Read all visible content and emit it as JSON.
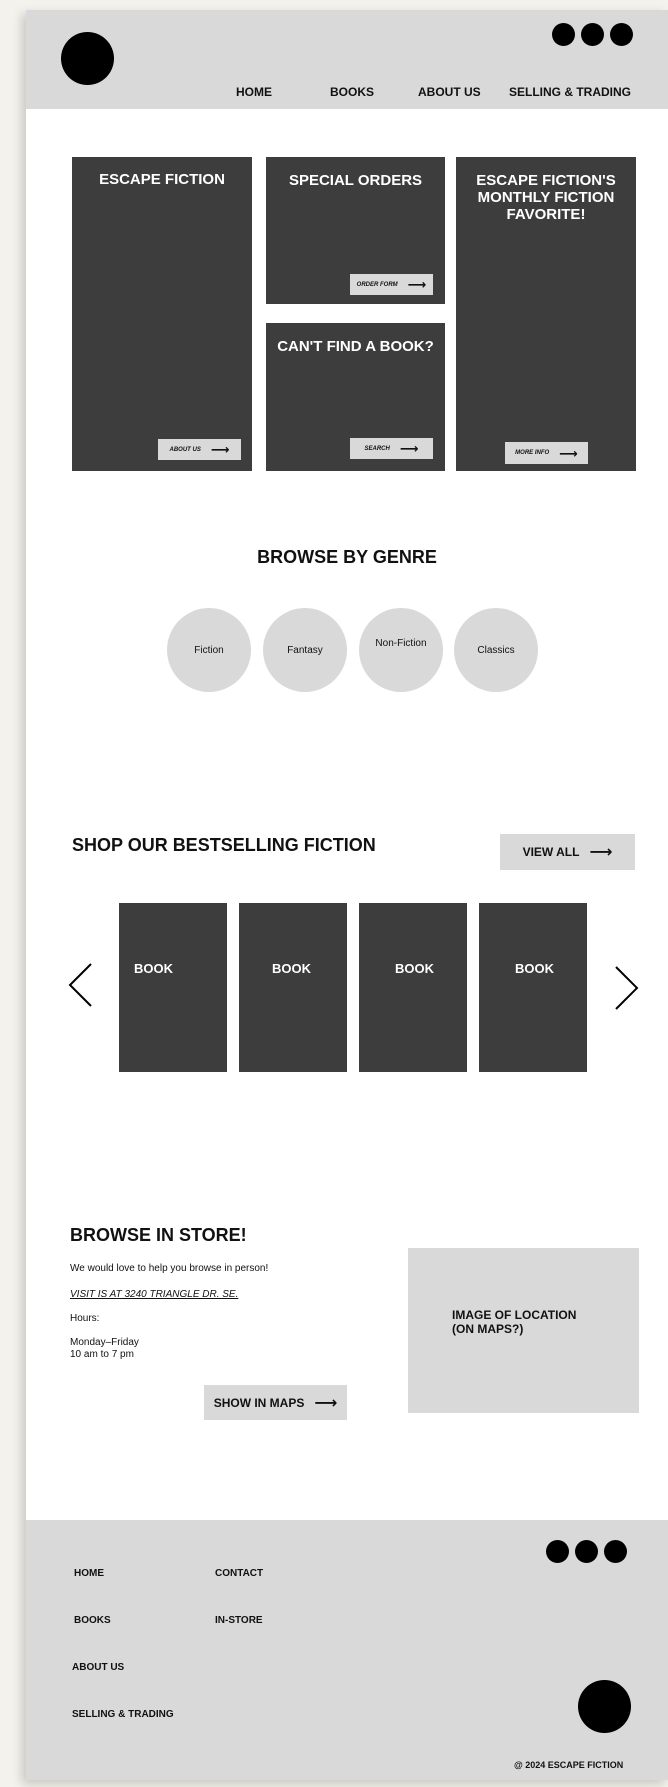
{
  "header": {
    "nav": [
      "HOME",
      "BOOKS",
      "ABOUT US",
      "SELLING & TRADING"
    ]
  },
  "panels": {
    "escape": {
      "title": "ESCAPE FICTION",
      "button": "ABOUT US"
    },
    "special": {
      "title": "SPECIAL ORDERS",
      "button": "ORDER FORM"
    },
    "cantfind": {
      "title": "CAN'T FIND A BOOK?",
      "button": "SEARCH"
    },
    "monthly": {
      "title": "ESCAPE FICTION'S MONTHLY FICTION FAVORITE!",
      "button": "MORE INFO"
    }
  },
  "genres": {
    "title": "BROWSE BY GENRE",
    "items": [
      "Fiction",
      "Fantasy",
      "Non-Fiction",
      "Classics"
    ]
  },
  "bestselling": {
    "title": "SHOP OUR BESTSELLING FICTION",
    "view_all": "VIEW ALL",
    "books": [
      "BOOK",
      "BOOK",
      "BOOK",
      "BOOK"
    ]
  },
  "instore": {
    "title": "BROWSE IN STORE!",
    "intro": "We would love to help you browse in person!",
    "address": "VISIT IS AT 3240 TRIANGLE DR. SE.",
    "hours_label": "Hours:",
    "days": "Monday–Friday",
    "times": "10 am to 7 pm",
    "maps_button": "SHOW IN MAPS",
    "location_line1": "IMAGE OF LOCATION",
    "location_line2": "(ON MAPS?)"
  },
  "footer": {
    "col1": [
      "HOME",
      "BOOKS",
      "ABOUT US",
      "SELLING & TRADING"
    ],
    "col2": [
      "CONTACT",
      "IN-STORE"
    ],
    "copyright": "@ 2024 ESCAPE FICTION"
  },
  "colors": {
    "dark_panel": "#3d3d3d",
    "light_gray": "#d9d9d9"
  },
  "icons": [
    "logo-circle",
    "social-dot",
    "arrow-right",
    "chevron-left",
    "chevron-right"
  ]
}
